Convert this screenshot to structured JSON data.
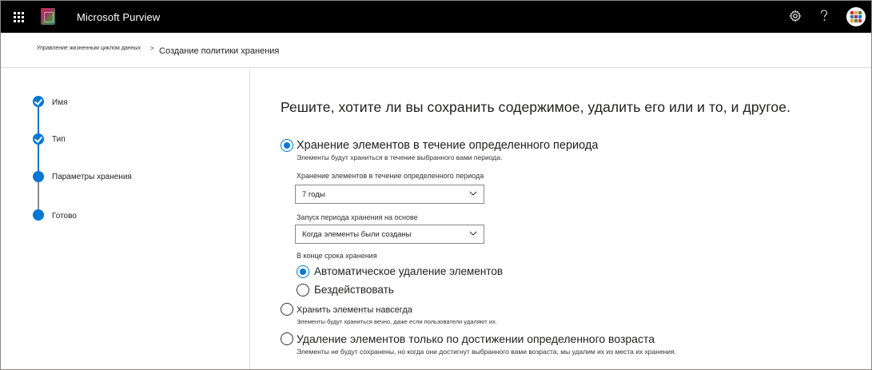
{
  "app": {
    "title": "Microsoft Purview",
    "icons": {
      "waffle": "app-launcher-icon",
      "settings": "gear-icon",
      "help": "help-icon",
      "avatar": "user-avatar"
    }
  },
  "breadcrumb": {
    "parent": "Управление жизненным циклом данных",
    "separator": "&gt;",
    "current": "Создание политики хранения"
  },
  "wizard": {
    "steps": [
      {
        "label": "Имя",
        "state": "complete"
      },
      {
        "label": "Тип",
        "state": "complete"
      },
      {
        "label": "Параметры хранения",
        "state": "current"
      },
      {
        "label": "Готово",
        "state": "pending"
      }
    ]
  },
  "main": {
    "heading": "Решите, хотите ли вы сохранить содержимое, удалить его или и то, и другое.",
    "options": [
      {
        "label": "Хранение элементов в течение определенного периода",
        "description": "Элементы будут храниться в течение выбранного вами периода.",
        "selected": true
      },
      {
        "label": "Хранить элементы навсегда",
        "description": "Элементы будут храниться вечно, даже если пользователи удаляют их.",
        "selected": false
      },
      {
        "label": "Удаление элементов только по достижении определенного возраста",
        "description": "Элементы не будут сохранены, но когда они достигнут выбранного вами возраста, мы удалим их из места их хранения.",
        "selected": false
      }
    ],
    "retention_period": {
      "label": "Хранение элементов в течение определенного периода",
      "value": "7 годы"
    },
    "start_based_on": {
      "label": "Запуск периода хранения на основе",
      "value": "Когда элементы были созданы"
    },
    "end_of_period": {
      "label": "В конце срока хранения",
      "choices": [
        {
          "label": "Автоматическое удаление элементов",
          "selected": true
        },
        {
          "label": "Бездействовать",
          "selected": false
        }
      ]
    }
  },
  "colors": {
    "accent": "#0078d4",
    "topbar": "#000000",
    "text": "#201f1e",
    "border": "#8a8886"
  }
}
